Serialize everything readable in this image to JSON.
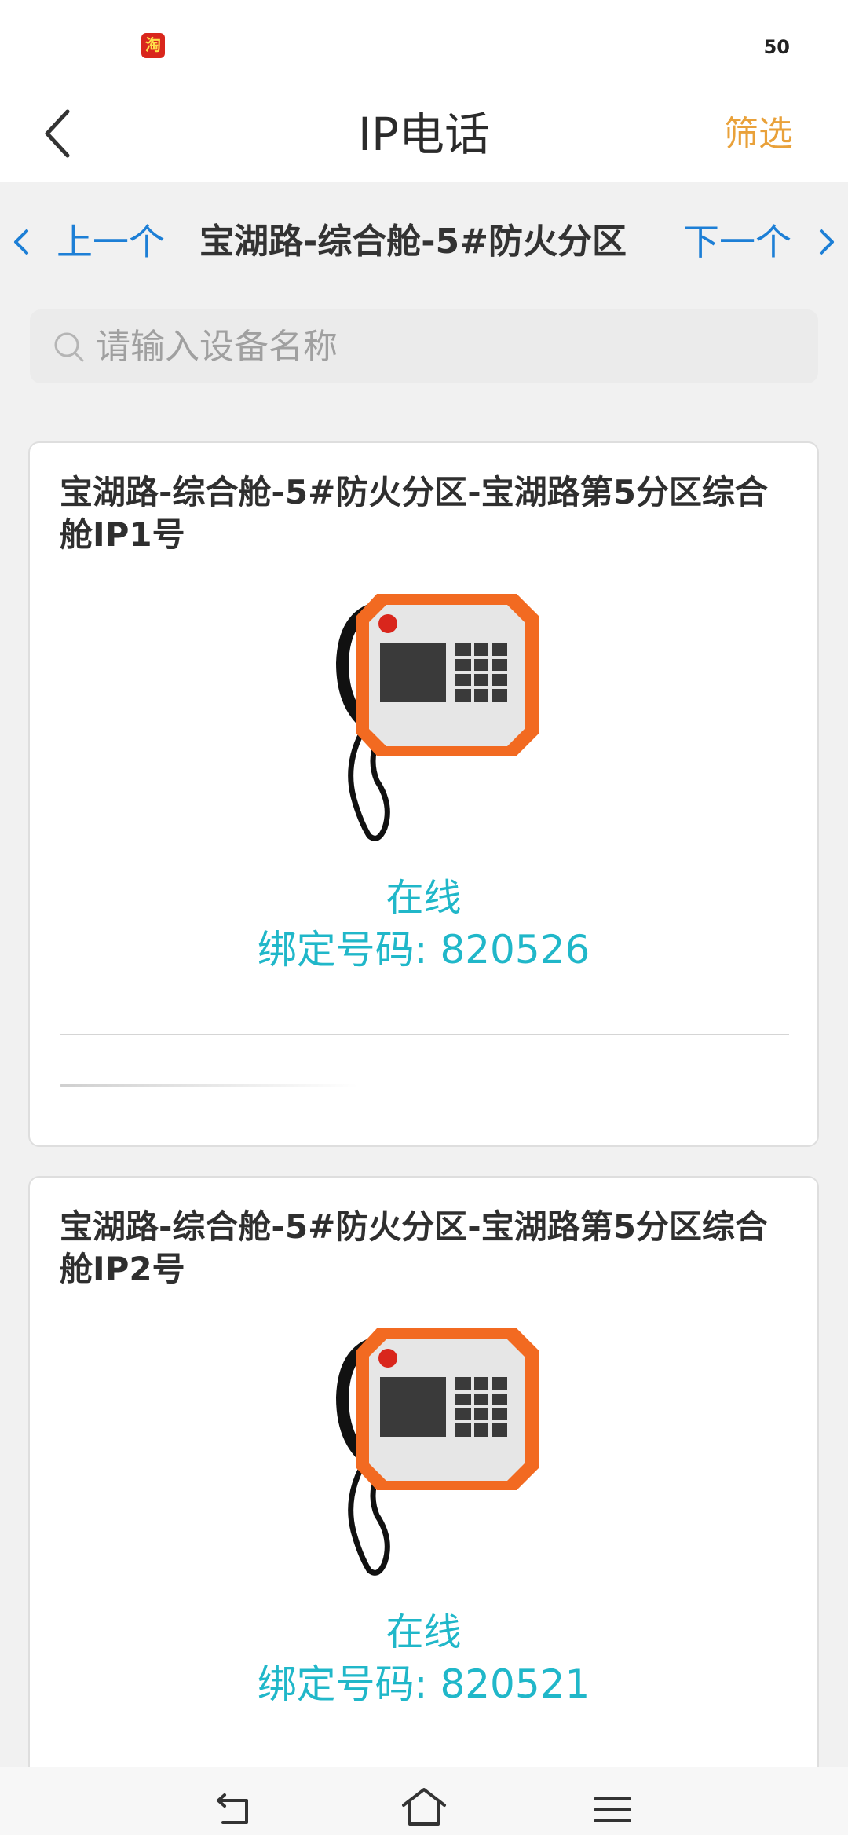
{
  "status_bar": {
    "app_icon_glyph": "淘",
    "battery_level": "50"
  },
  "header": {
    "title": "IP电话",
    "filter_label": "筛选"
  },
  "pager": {
    "prev_label": "上一个",
    "current_area": "宝湖路-综合舱-5#防火分区",
    "next_label": "下一个"
  },
  "search": {
    "placeholder": "请输入设备名称",
    "value": ""
  },
  "devices": [
    {
      "name": "宝湖路-综合舱-5#防火分区-宝湖路第5分区综合舱IP1号",
      "status": "在线",
      "number_label": "绑定号码: ",
      "number": "820526"
    },
    {
      "name": "宝湖路-综合舱-5#防火分区-宝湖路第5分区综合舱IP2号",
      "status": "在线",
      "number_label": "绑定号码: ",
      "number": "820521"
    }
  ],
  "colors": {
    "accent_blue": "#1d7fd6",
    "filter_orange": "#e9a13a",
    "online_cyan": "#20b7c9",
    "phone_orange": "#f26a21"
  },
  "icons": {
    "back": "chevron-left-icon",
    "search": "search-icon",
    "device": "ip-phone-icon",
    "nav_back": "nav-back-icon",
    "nav_home": "nav-home-icon",
    "nav_menu": "nav-menu-icon"
  }
}
